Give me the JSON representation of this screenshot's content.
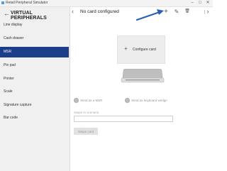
{
  "window": {
    "title": "Retail Peripheral Simulator",
    "controls": [
      "–",
      "□",
      "✕"
    ]
  },
  "sidebar": {
    "back_icon": "back-arrow-icon",
    "title": "VIRTUAL PERIPHERALS",
    "items": [
      {
        "label": "Line display",
        "active": false
      },
      {
        "label": "Cash drawer",
        "active": false
      },
      {
        "label": "MSR",
        "active": true
      },
      {
        "label": "Pin pad",
        "active": false
      },
      {
        "label": "Printer",
        "active": false
      },
      {
        "label": "Scale",
        "active": false
      },
      {
        "label": "Signature capture",
        "active": false
      },
      {
        "label": "Bar code",
        "active": false
      }
    ],
    "active_color": "#1c3e8a"
  },
  "main": {
    "card_title": "No card configured",
    "toolbar": {
      "prev_glyph": "‹",
      "add_glyph": "+",
      "edit_glyph": "✎",
      "delete_glyph": "🗑",
      "next_glyph": "›"
    },
    "configure_card": {
      "plus_glyph": "+",
      "label": "Configure card"
    },
    "options": [
      {
        "label": "Send as a MSR"
      },
      {
        "label": "Send as keyboard wedge"
      }
    ],
    "swipe_label": "Swipe in scenario",
    "swipe_value": "",
    "swipe_button": "Swipe card"
  },
  "annotation": {
    "color": "#2a5fb5"
  }
}
